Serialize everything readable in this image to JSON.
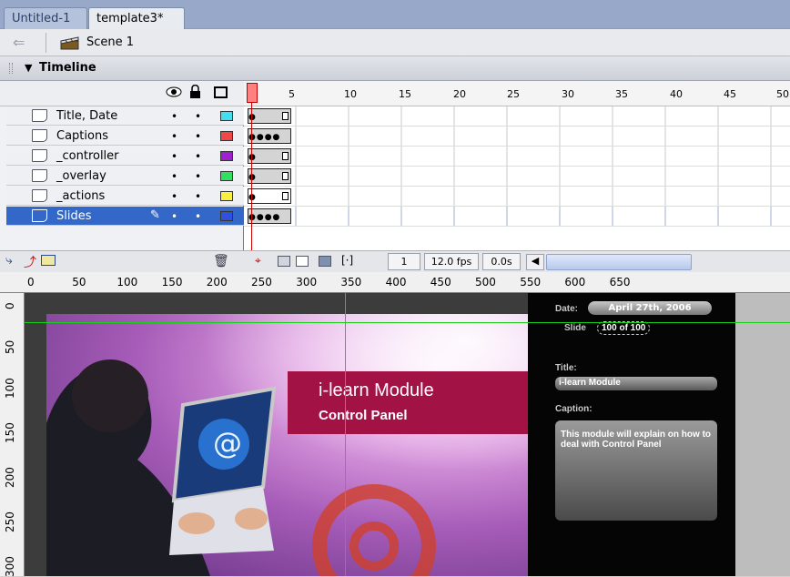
{
  "tabs": [
    {
      "label": "Untitled-1"
    },
    {
      "label": "template3*"
    }
  ],
  "editbar": {
    "scene_label": "Scene 1"
  },
  "timeline": {
    "title": "Timeline",
    "layers": [
      {
        "name": "Title, Date",
        "color": "#40e0f0"
      },
      {
        "name": "Captions",
        "color": "#f04848"
      },
      {
        "name": "_controller",
        "color": "#a020d0"
      },
      {
        "name": "_overlay",
        "color": "#30e060"
      },
      {
        "name": "_actions",
        "color": "#f8f040"
      },
      {
        "name": "Slides",
        "color": "#3050e0"
      }
    ],
    "frame_numbers": [
      "1",
      "5",
      "10",
      "15",
      "20",
      "25",
      "30",
      "35",
      "40",
      "45",
      "50"
    ],
    "current_frame": "1",
    "fps": "12.0 fps",
    "time": "0.0s"
  },
  "ruler": {
    "h_labels": [
      "0",
      "50",
      "100",
      "150",
      "200",
      "250",
      "300",
      "350",
      "400",
      "450",
      "500",
      "550",
      "600",
      "650"
    ],
    "v_labels": [
      "0",
      "50",
      "100",
      "150",
      "200",
      "250",
      "300"
    ]
  },
  "stage": {
    "banner_title": "i-learn Module",
    "banner_subtitle": "Control Panel",
    "date_label": "Date:",
    "date_value": "April 27th, 2006",
    "slide_label": "Slide",
    "slide_value": "100 of 100",
    "title_label": "Title:",
    "title_value": "i-learn Module",
    "caption_label": "Caption:",
    "caption_value": "This module will explain on how to deal with Control Panel"
  }
}
